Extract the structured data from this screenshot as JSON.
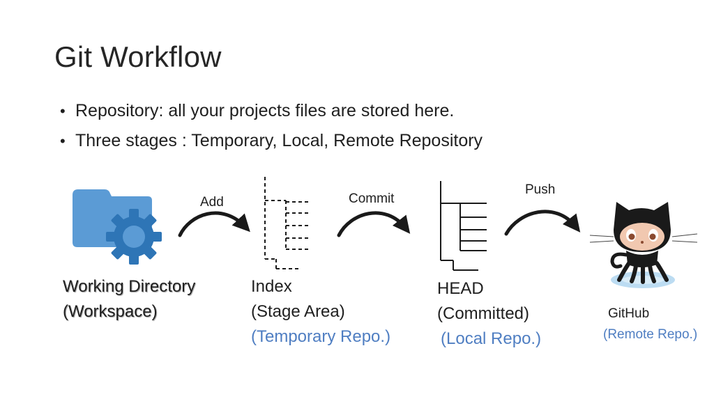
{
  "title": "Git Workflow",
  "bullets": [
    "Repository: all your projects files are stored here.",
    "Three stages : Temporary, Local, Remote Repository"
  ],
  "arrows": {
    "add": "Add",
    "commit": "Commit",
    "push": "Push"
  },
  "stages": {
    "working": {
      "line1": "Working Directory",
      "line2": "(Workspace)"
    },
    "index": {
      "line1": "Index",
      "line2": "(Stage Area)",
      "sub": "(Temporary Repo.)"
    },
    "head": {
      "line1": "HEAD",
      "line2": "(Committed)",
      "sub": "(Local Repo.)"
    },
    "github": {
      "line1": "GitHub",
      "sub": "(Remote Repo.)"
    }
  },
  "icons": {
    "working": "folder-gear-icon",
    "index": "dashed-tree-icon",
    "head": "solid-tree-icon",
    "github": "octocat-icon"
  },
  "colors": {
    "folder": "#5b9bd5",
    "gear": "#2e75b6",
    "accent_text": "#4f7ec2",
    "ink": "#1f1f1f"
  }
}
